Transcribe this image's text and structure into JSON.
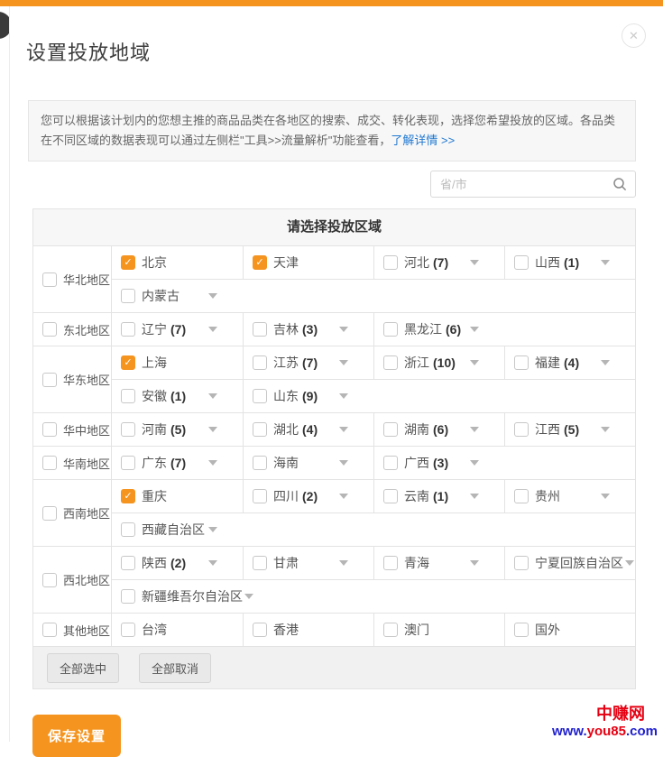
{
  "dialog": {
    "title": "设置投放地域",
    "close_glyph": "✕"
  },
  "notice": {
    "text_before_link": "您可以根据该计划内的您想主推的商品品类在各地区的搜索、成交、转化表现，选择您希望投放的区域。各品类在不同区域的数据表现可以通过左侧栏\"工具>>流量解析\"功能查看，",
    "link_text": "了解详情 >>"
  },
  "search": {
    "placeholder": "省/市"
  },
  "table": {
    "header": "请选择投放区域",
    "regions": [
      {
        "label": "华北地区",
        "checked": false,
        "rows": [
          [
            {
              "label": "北京",
              "checked": true
            },
            {
              "label": "天津",
              "checked": true
            },
            {
              "label": "河北",
              "count": "(7)",
              "dropdown": true
            },
            {
              "label": "山西",
              "count": "(1)",
              "dropdown": true
            }
          ],
          [
            {
              "label": "内蒙古",
              "dropdown": true
            }
          ]
        ]
      },
      {
        "label": "东北地区",
        "checked": false,
        "rows": [
          [
            {
              "label": "辽宁",
              "count": "(7)",
              "dropdown": true
            },
            {
              "label": "吉林",
              "count": "(3)",
              "dropdown": true
            },
            {
              "label": "黑龙江",
              "count": "(6)",
              "dropdown": true
            }
          ]
        ]
      },
      {
        "label": "华东地区",
        "checked": false,
        "rows": [
          [
            {
              "label": "上海",
              "checked": true
            },
            {
              "label": "江苏",
              "count": "(7)",
              "dropdown": true
            },
            {
              "label": "浙江",
              "count": "(10)",
              "dropdown": true
            },
            {
              "label": "福建",
              "count": "(4)",
              "dropdown": true
            }
          ],
          [
            {
              "label": "安徽",
              "count": "(1)",
              "dropdown": true
            },
            {
              "label": "山东",
              "count": "(9)",
              "dropdown": true
            }
          ]
        ]
      },
      {
        "label": "华中地区",
        "checked": false,
        "rows": [
          [
            {
              "label": "河南",
              "count": "(5)",
              "dropdown": true
            },
            {
              "label": "湖北",
              "count": "(4)",
              "dropdown": true
            },
            {
              "label": "湖南",
              "count": "(6)",
              "dropdown": true
            },
            {
              "label": "江西",
              "count": "(5)",
              "dropdown": true
            }
          ]
        ]
      },
      {
        "label": "华南地区",
        "checked": false,
        "rows": [
          [
            {
              "label": "广东",
              "count": "(7)",
              "dropdown": true
            },
            {
              "label": "海南",
              "dropdown": true
            },
            {
              "label": "广西",
              "count": "(3)",
              "dropdown": true
            }
          ]
        ]
      },
      {
        "label": "西南地区",
        "checked": false,
        "rows": [
          [
            {
              "label": "重庆",
              "checked": true
            },
            {
              "label": "四川",
              "count": "(2)",
              "dropdown": true
            },
            {
              "label": "云南",
              "count": "(1)",
              "dropdown": true
            },
            {
              "label": "贵州",
              "dropdown": true
            }
          ],
          [
            {
              "label": "西藏自治区",
              "dropdown": true
            }
          ]
        ]
      },
      {
        "label": "西北地区",
        "checked": false,
        "rows": [
          [
            {
              "label": "陕西",
              "count": "(2)",
              "dropdown": true
            },
            {
              "label": "甘肃",
              "dropdown": true
            },
            {
              "label": "青海",
              "dropdown": true
            },
            {
              "label": "宁夏回族自治区",
              "dropdown": true
            }
          ],
          [
            {
              "label": "新疆维吾尔自治区",
              "dropdown": true
            }
          ]
        ]
      },
      {
        "label": "其他地区",
        "checked": false,
        "rows": [
          [
            {
              "label": "台湾"
            },
            {
              "label": "香港"
            },
            {
              "label": "澳门"
            },
            {
              "label": "国外"
            }
          ]
        ]
      }
    ],
    "footer_buttons": [
      "全部选中",
      "全部取消"
    ]
  },
  "actions": {
    "save_label": "保存设置"
  },
  "watermark": {
    "site_name": "中赚网",
    "url_www": "www.",
    "url_mid": "you85",
    "url_com": ".com"
  },
  "colors": {
    "accent_orange": "#f5941f",
    "link_blue": "#2079d2",
    "watermark_red": "#e60012",
    "watermark_blue": "#2121cf"
  }
}
